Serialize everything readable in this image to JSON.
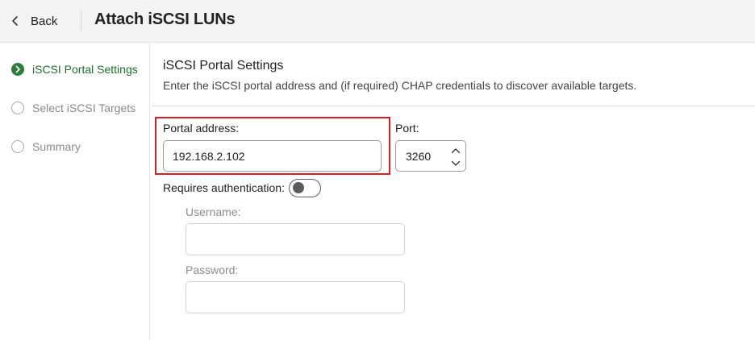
{
  "header": {
    "back_label": "Back",
    "title": "Attach iSCSI LUNs"
  },
  "steps": [
    {
      "label": "iSCSI Portal Settings",
      "state": "active"
    },
    {
      "label": "Select iSCSI Targets",
      "state": "pending"
    },
    {
      "label": "Summary",
      "state": "pending"
    }
  ],
  "section": {
    "title": "iSCSI Portal Settings",
    "description": "Enter the iSCSI portal address and (if required) CHAP credentials to discover available targets."
  },
  "form": {
    "portal_address_label": "Portal address:",
    "portal_address_value": "192.168.2.102",
    "port_label": "Port:",
    "port_value": "3260",
    "requires_auth_label": "Requires authentication:",
    "requires_auth_on": false,
    "username_label": "Username:",
    "username_value": "",
    "password_label": "Password:",
    "password_value": ""
  },
  "colors": {
    "accent_green": "#2f7d3a",
    "highlight_red": "#d62027"
  },
  "icons": {
    "back": "chevron-left-icon",
    "active_step": "chevron-right-circle-icon",
    "port_up": "chevron-up-icon",
    "port_down": "chevron-down-icon"
  }
}
